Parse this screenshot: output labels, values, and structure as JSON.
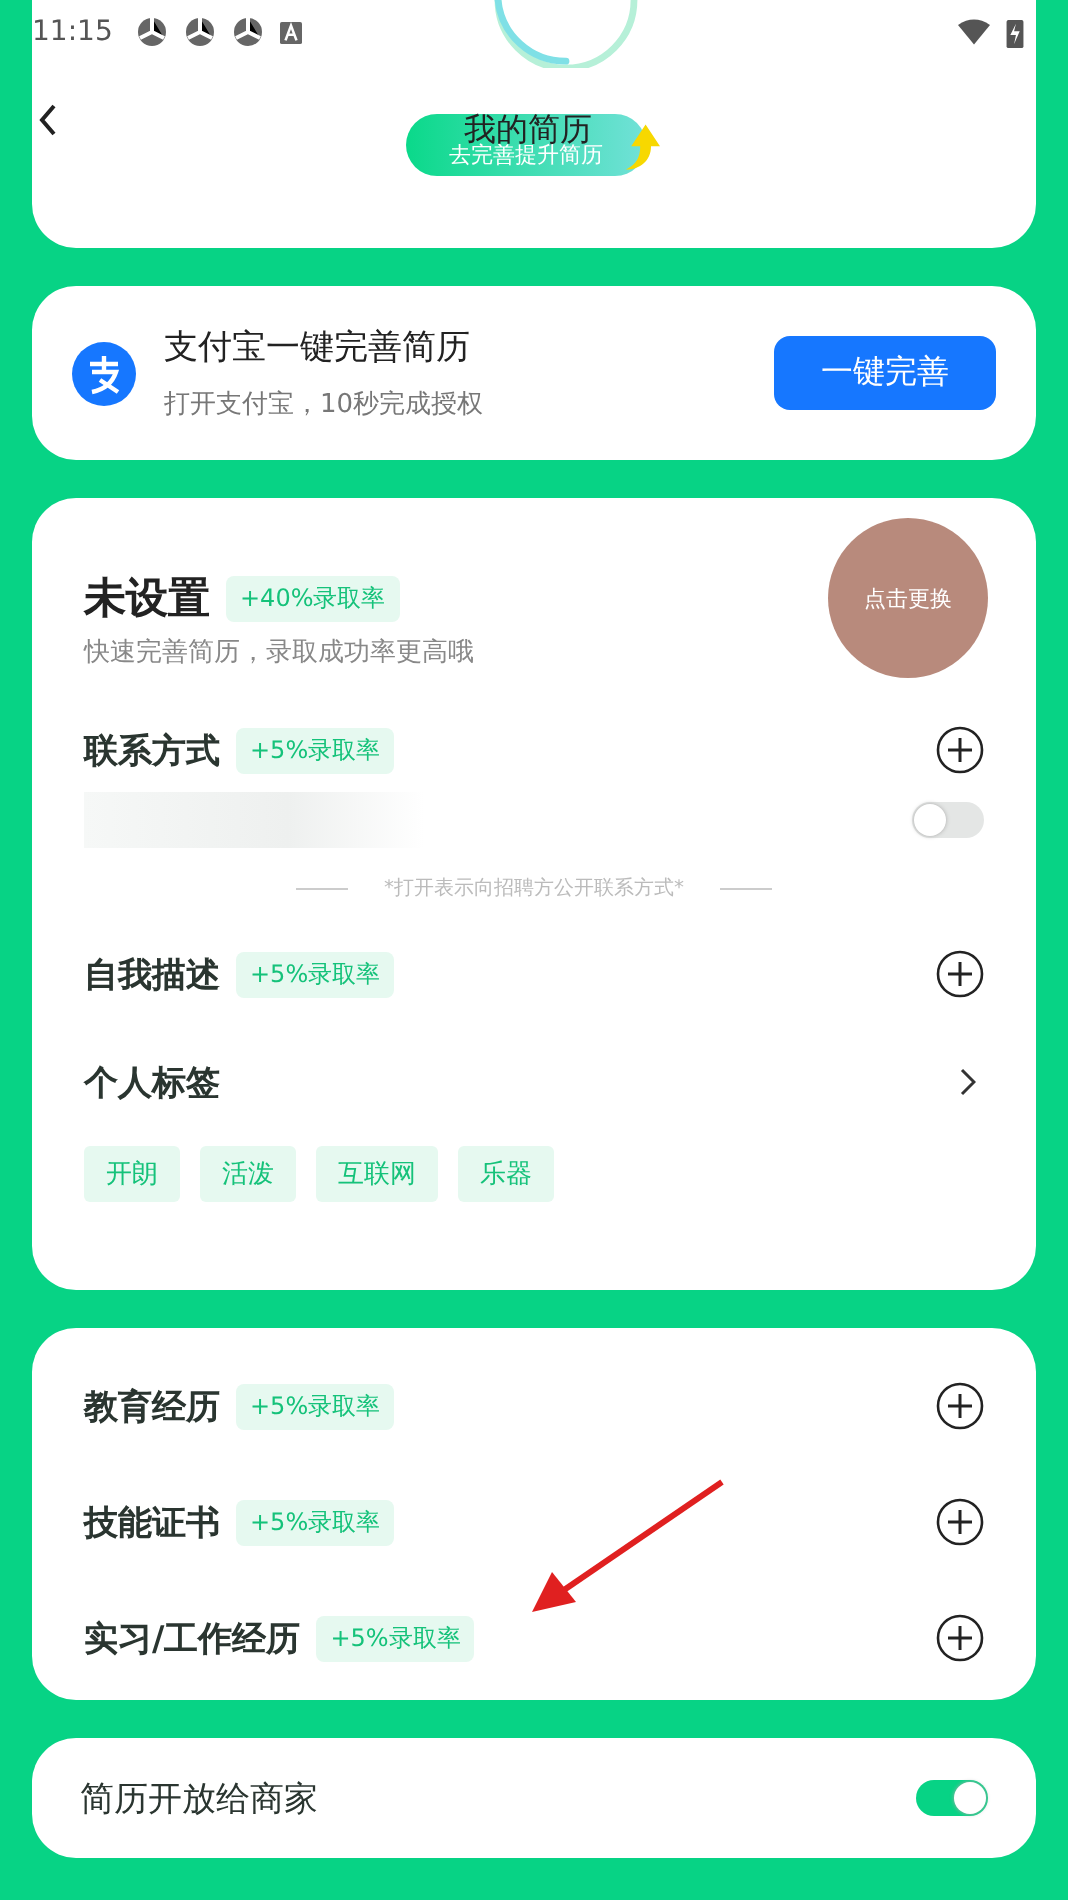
{
  "status_bar": {
    "time": "11:15"
  },
  "header": {
    "title": "我的简历",
    "promo_button": "去完善提升简历"
  },
  "alipay_card": {
    "title": "支付宝一键完善简历",
    "subtitle": "打开支付宝，10秒完成授权",
    "button": "一键完善"
  },
  "profile": {
    "name": "未设置",
    "badge": "+40%录取率",
    "hint": "快速完善简历，录取成功率更高哦",
    "avatar_label": "点击更换"
  },
  "contact": {
    "title": "联系方式",
    "badge": "+5%录取率",
    "public": false,
    "note": "*打开表示向招聘方公开联系方式*"
  },
  "about": {
    "title": "自我描述",
    "badge": "+5%录取率"
  },
  "tags": {
    "title": "个人标签",
    "items": [
      "开朗",
      "活泼",
      "互联网",
      "乐器"
    ]
  },
  "sections": [
    {
      "title": "教育经历",
      "badge": "+5%录取率"
    },
    {
      "title": "技能证书",
      "badge": "+5%录取率"
    },
    {
      "title": "实习/工作经历",
      "badge": "+5%录取率"
    }
  ],
  "open_to_business": {
    "title": "简历开放给商家",
    "on": true
  }
}
